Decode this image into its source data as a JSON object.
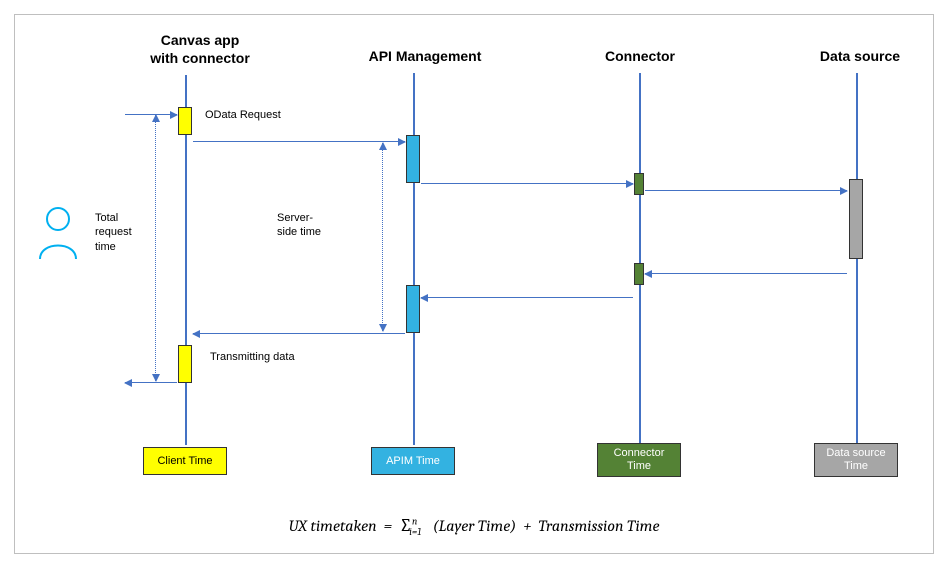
{
  "headers": {
    "canvas": "Canvas app\nwith connector",
    "apim": "API Management",
    "connector": "Connector",
    "datasource": "Data source"
  },
  "labels": {
    "odata_request": "OData Request",
    "transmitting": "Transmitting data",
    "total_request_time": "Total\nrequest\ntime",
    "server_side_time": "Server-\nside time"
  },
  "footer": {
    "client": "Client Time",
    "apim": "APIM Time",
    "connector": "Connector\nTime",
    "datasource": "Data source\nTime"
  },
  "formula": {
    "lhs": "UX timetaken",
    "eq": "=",
    "sum_lower": "i=1",
    "sum_upper": "n",
    "term1": "(Layer Time)",
    "plus": "+",
    "term2": "Transmission Time"
  },
  "chart_data": {
    "type": "diagram",
    "title": "UX time taken across layers (sequence diagram)",
    "lifelines": [
      {
        "name": "Canvas app with connector",
        "color": "#ffff00",
        "footer": "Client Time"
      },
      {
        "name": "API Management",
        "color": "#33b2e1",
        "footer": "APIM Time"
      },
      {
        "name": "Connector",
        "color": "#548235",
        "footer": "Connector Time"
      },
      {
        "name": "Data source",
        "color": "#a6a6a6",
        "footer": "Data source Time"
      }
    ],
    "messages": [
      {
        "from": "User",
        "to": "Canvas app with connector",
        "label": ""
      },
      {
        "from": "Canvas app with connector",
        "to": "API Management",
        "label": "OData Request"
      },
      {
        "from": "API Management",
        "to": "Connector",
        "label": ""
      },
      {
        "from": "Connector",
        "to": "Data source",
        "label": ""
      },
      {
        "from": "Data source",
        "to": "Connector",
        "label": ""
      },
      {
        "from": "Connector",
        "to": "API Management",
        "label": ""
      },
      {
        "from": "API Management",
        "to": "Canvas app with connector",
        "label": "Transmitting data"
      },
      {
        "from": "Canvas app with connector",
        "to": "User",
        "label": ""
      }
    ],
    "spans": [
      {
        "name": "Total request time",
        "covers": [
          "Canvas app with connector"
        ]
      },
      {
        "name": "Server-side time",
        "covers": [
          "API Management"
        ]
      }
    ],
    "formula": "UX timetaken = Σ_{i=1}^{n} (Layer Time) + Transmission Time"
  }
}
